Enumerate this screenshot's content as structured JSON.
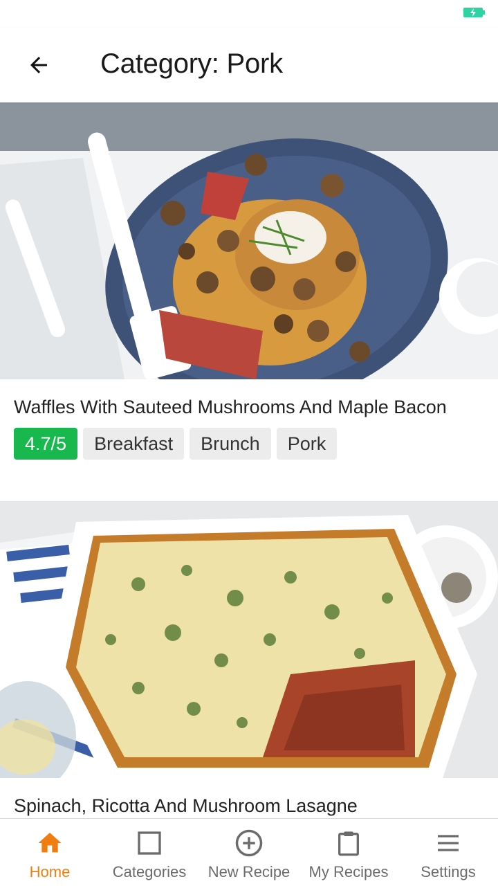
{
  "header": {
    "title": "Category: Pork",
    "back_icon": "arrow-left-icon"
  },
  "status_bar": {
    "battery_icon": "battery-charging-icon",
    "battery_color": "#2ed3a4"
  },
  "recipes": [
    {
      "title": "Waffles With Sauteed Mushrooms And Maple Bacon",
      "rating": "4.7/5",
      "tags": [
        "Breakfast",
        "Brunch",
        "Pork"
      ],
      "image": "waffles-mushrooms-bacon-photo"
    },
    {
      "title": "Spinach, Ricotta And Mushroom Lasagne",
      "image": "spinach-ricotta-lasagne-photo"
    }
  ],
  "nav": {
    "items": [
      {
        "label": "Home",
        "icon": "home-icon",
        "active": true
      },
      {
        "label": "Categories",
        "icon": "square-icon",
        "active": false
      },
      {
        "label": "New Recipe",
        "icon": "plus-circle-icon",
        "active": false
      },
      {
        "label": "My Recipes",
        "icon": "clipboard-icon",
        "active": false
      },
      {
        "label": "Settings",
        "icon": "menu-icon",
        "active": false
      }
    ]
  },
  "colors": {
    "accent": "#f07d12",
    "rating_badge": "#19b84e",
    "tag_bg": "#ececec"
  }
}
